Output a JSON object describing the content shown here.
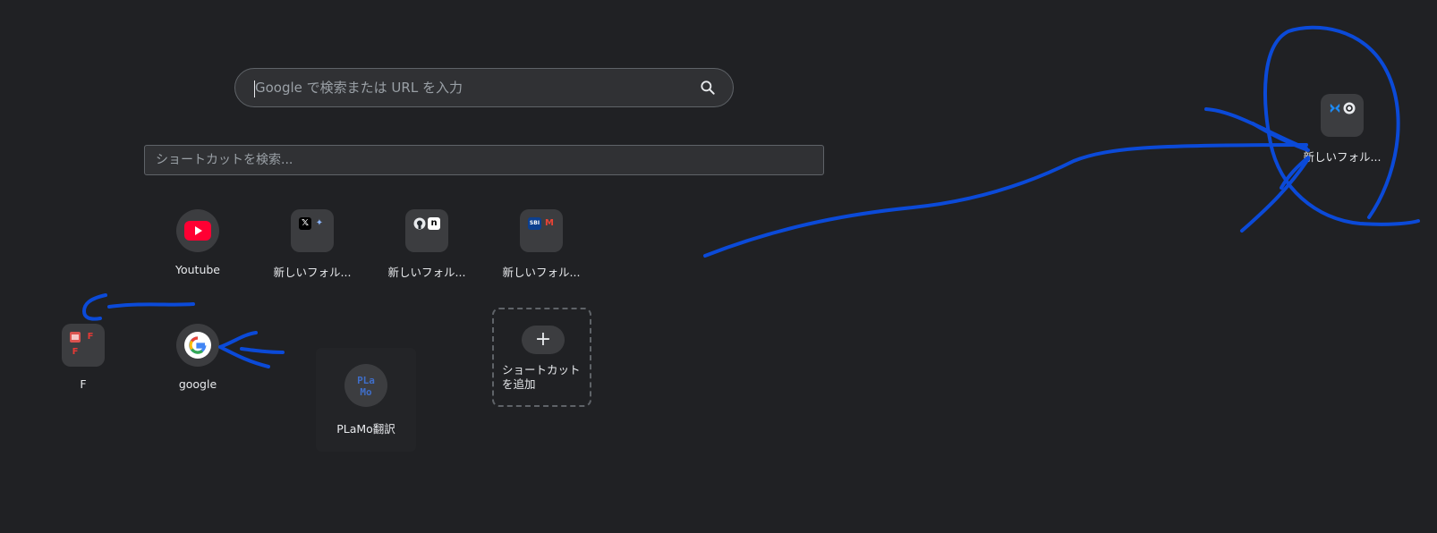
{
  "search": {
    "placeholder": "Google で検索または URL を入力"
  },
  "shortcut_filter": {
    "placeholder": "ショートカットを検索..."
  },
  "shortcuts": {
    "youtube": {
      "label": "Youtube"
    },
    "folder1": {
      "label": "新しいフォル...",
      "badges": [
        "𝕏",
        "✦"
      ]
    },
    "folder2": {
      "label": "新しいフォル...",
      "badges": [
        "n"
      ]
    },
    "folder3": {
      "label": "新しいフォル...",
      "badges": [
        "SBI",
        "M"
      ]
    },
    "folder_f": {
      "label": "F",
      "badges": [
        "F",
        "F"
      ]
    },
    "google": {
      "label": "google",
      "badge": "G"
    },
    "plamo": {
      "label": "PLaMo翻訳",
      "badge": "PLa\nMo"
    },
    "folder_right": {
      "label": "新しいフォル..."
    }
  },
  "add_shortcut": {
    "plus": "+",
    "label": "ショートカットを追加"
  },
  "colors": {
    "background": "#202124",
    "annotation": "#0b4ad8",
    "youtube_red": "#ff0033"
  }
}
